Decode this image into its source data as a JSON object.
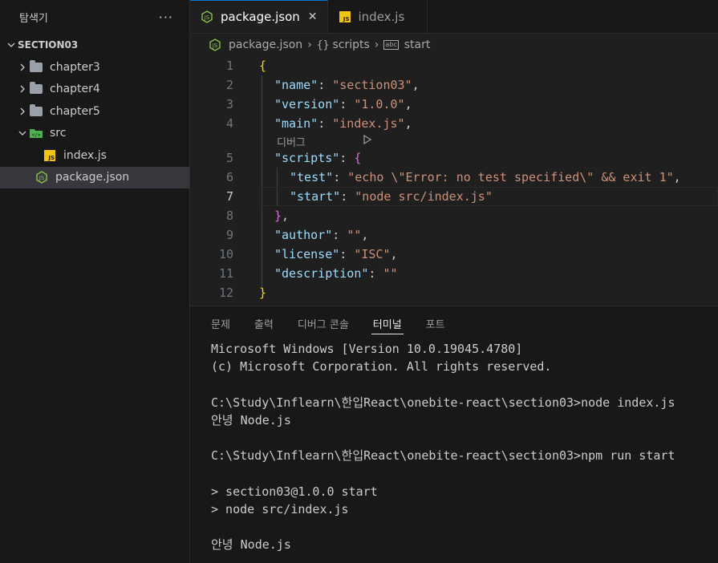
{
  "sidebar": {
    "title": "탐색기",
    "more": "···",
    "section": "SECTION03",
    "items": [
      {
        "label": "chapter3",
        "type": "folder"
      },
      {
        "label": "chapter4",
        "type": "folder"
      },
      {
        "label": "chapter5",
        "type": "folder"
      },
      {
        "label": "src",
        "type": "folder-open"
      },
      {
        "label": "index.js",
        "type": "js"
      },
      {
        "label": "package.json",
        "type": "node"
      }
    ]
  },
  "tabs": [
    {
      "label": "package.json",
      "active": true,
      "close": "✕"
    },
    {
      "label": "index.js",
      "active": false
    }
  ],
  "breadcrumb": {
    "file": "package.json",
    "sym1": "{}",
    "item1": "scripts",
    "sym2": "abc",
    "item2": "start"
  },
  "code": {
    "line_numbers": [
      "1",
      "2",
      "3",
      "4",
      "5",
      "6",
      "7",
      "8",
      "9",
      "10",
      "11",
      "12"
    ],
    "codelens": "디버그",
    "l1": "{",
    "l2k": "\"name\"",
    "l2v": "\"section03\"",
    "l3k": "\"version\"",
    "l3v": "\"1.0.0\"",
    "l4k": "\"main\"",
    "l4v": "\"index.js\"",
    "l5k": "\"scripts\"",
    "l5b": "{",
    "l6k": "\"test\"",
    "l6v": "\"echo \\\"Error: no test specified\\\" && exit 1\"",
    "l7k": "\"start\"",
    "l7v": "\"node src/index.js\"",
    "l8b": "}",
    "l9k": "\"author\"",
    "l9v": "\"\"",
    "l10k": "\"license\"",
    "l10v": "\"ISC\"",
    "l11k": "\"description\"",
    "l11v": "\"\"",
    "l12": "}"
  },
  "panel": {
    "tabs": [
      "문제",
      "출력",
      "디버그 콘솔",
      "터미널",
      "포트"
    ],
    "active_tab": "터미널",
    "terminal": [
      "Microsoft Windows [Version 10.0.19045.4780]",
      "(c) Microsoft Corporation. All rights reserved.",
      "",
      "C:\\Study\\Inflearn\\한입React\\onebite-react\\section03>node index.js",
      "안녕 Node.js",
      "",
      "C:\\Study\\Inflearn\\한입React\\onebite-react\\section03>npm run start",
      "",
      "> section03@1.0.0 start",
      "> node src/index.js",
      "",
      "안녕 Node.js"
    ]
  },
  "colors": {
    "accent": "#0078d4",
    "key": "#9cdcfe",
    "string": "#ce9178",
    "bracket1": "#ffd700",
    "bracket2": "#da70d6"
  }
}
